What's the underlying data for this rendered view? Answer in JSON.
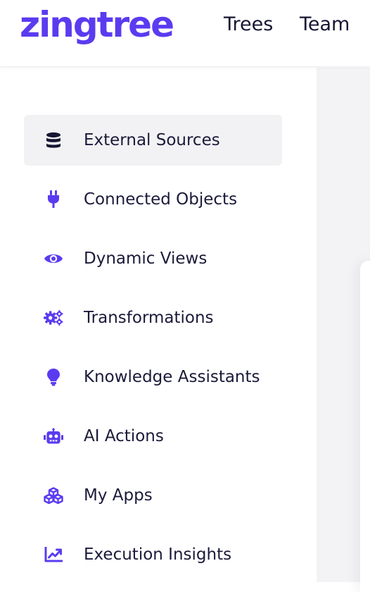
{
  "brand": {
    "logo_text": "zingtree",
    "accent_color": "#5b3bf0",
    "text_color": "#1b1a3a"
  },
  "topnav": {
    "items": [
      {
        "label": "Trees"
      },
      {
        "label": "Team"
      }
    ]
  },
  "sidebar": {
    "active_index": 0,
    "items": [
      {
        "label": "External Sources",
        "icon": "database-icon"
      },
      {
        "label": "Connected Objects",
        "icon": "plug-icon"
      },
      {
        "label": "Dynamic Views",
        "icon": "eye-icon"
      },
      {
        "label": "Transformations",
        "icon": "gears-icon"
      },
      {
        "label": "Knowledge Assistants",
        "icon": "lightbulb-icon"
      },
      {
        "label": "AI Actions",
        "icon": "robot-icon"
      },
      {
        "label": "My Apps",
        "icon": "cubes-icon"
      },
      {
        "label": "Execution Insights",
        "icon": "chart-line-icon"
      }
    ]
  }
}
